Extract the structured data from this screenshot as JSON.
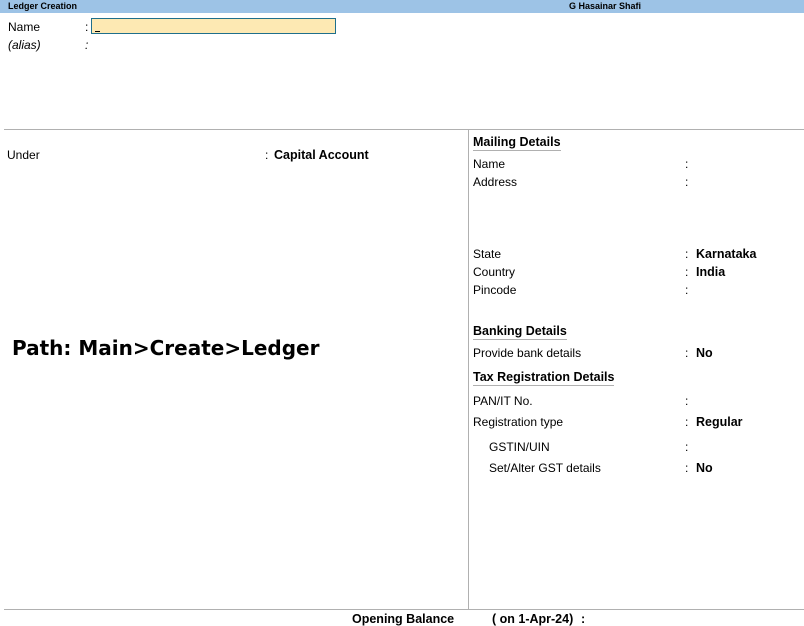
{
  "window": {
    "title": "Ledger Creation",
    "company": "G Hasainar Shafi"
  },
  "header": {
    "name_label": "Name",
    "name_value": "",
    "alias_label": "(alias)",
    "colon": ":"
  },
  "left": {
    "under_label": "Under",
    "under_value": "Capital Account"
  },
  "path_note": "Path: Main>Create>Ledger",
  "mailing": {
    "title": "Mailing Details",
    "name_label": "Name",
    "address_label": "Address",
    "state_label": "State",
    "state_value": "Karnataka",
    "country_label": "Country",
    "country_value": "India",
    "pincode_label": "Pincode"
  },
  "banking": {
    "title": "Banking Details",
    "provide_label": "Provide bank details",
    "provide_value": "No"
  },
  "tax": {
    "title": "Tax Registration Details",
    "pan_label": "PAN/IT No.",
    "regtype_label": "Registration type",
    "regtype_value": "Regular",
    "gstin_label": "GSTIN/UIN",
    "gst_alter_label": "Set/Alter GST details",
    "gst_alter_value": "No"
  },
  "footer": {
    "opening_label": "Opening Balance",
    "opening_date": "( on 1-Apr-24)",
    "colon": ":"
  }
}
